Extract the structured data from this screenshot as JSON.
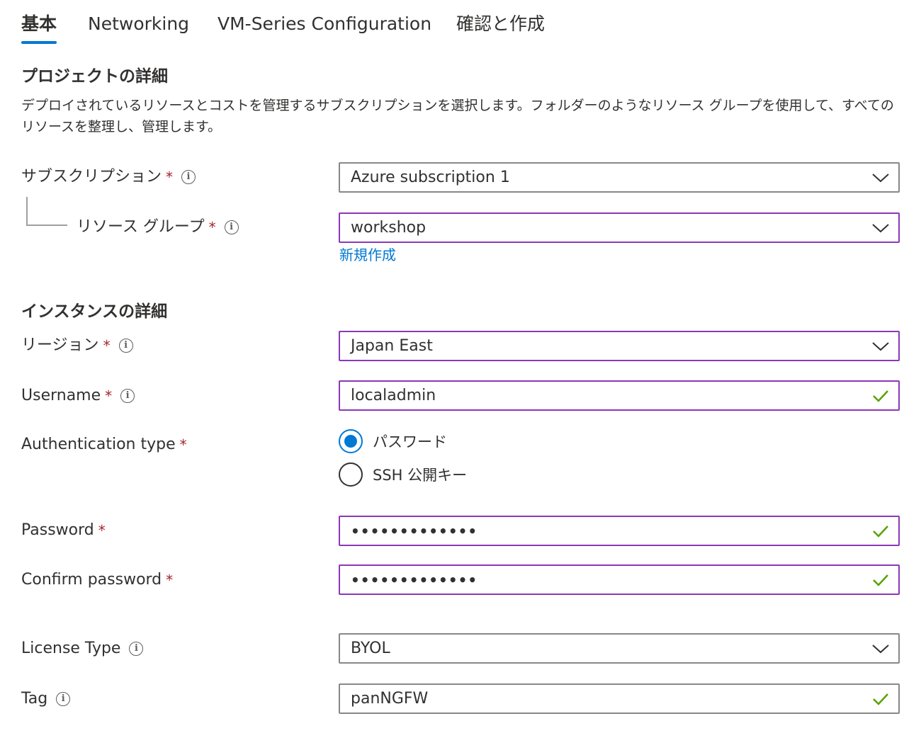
{
  "tabs": [
    {
      "label": "基本",
      "active": true
    },
    {
      "label": "Networking"
    },
    {
      "label": "VM-Series Configuration"
    },
    {
      "label": "確認と作成"
    }
  ],
  "project": {
    "title": "プロジェクトの詳細",
    "description": "デプロイされているリソースとコストを管理するサブスクリプションを選択します。フォルダーのようなリソース グループを使用して、すべてのリソースを整理し、管理します。",
    "subscription_label": "サブスクリプション",
    "subscription_value": "Azure subscription 1",
    "resource_group_label": "リソース グループ",
    "resource_group_value": "workshop",
    "create_new_link": "新規作成"
  },
  "instance": {
    "title": "インスタンスの詳細",
    "region_label": "リージョン",
    "region_value": "Japan East",
    "username_label": "Username",
    "username_value": "localadmin",
    "auth_label": "Authentication type",
    "auth_options": [
      "パスワード",
      "SSH 公開キー"
    ],
    "auth_selected": "パスワード",
    "password_label": "Password",
    "password_mask": "•••••••••••••",
    "confirm_label": "Confirm password",
    "confirm_mask": "•••••••••••••",
    "license_label": "License Type",
    "license_value": "BYOL",
    "tag_label": "Tag",
    "tag_value": "panNGFW"
  },
  "required_mark": "*",
  "info_glyph": "i",
  "colors": {
    "accent": "#0078d4",
    "validated_border": "#8a38b8",
    "check": "#57a300",
    "required": "#a4262c"
  }
}
